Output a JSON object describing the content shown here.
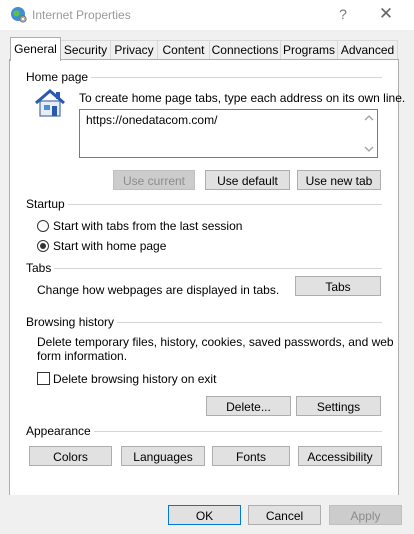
{
  "window": {
    "title": "Internet Properties",
    "help_glyph": "?",
    "close_glyph": "✕",
    "icon": "globe-settings-icon"
  },
  "tabs": [
    {
      "label": "General",
      "active": true
    },
    {
      "label": "Security"
    },
    {
      "label": "Privacy"
    },
    {
      "label": "Content"
    },
    {
      "label": "Connections"
    },
    {
      "label": "Programs"
    },
    {
      "label": "Advanced"
    }
  ],
  "home_page": {
    "title": "Home page",
    "instruction": "To create home page tabs, type each address on its own line.",
    "url": "https://onedatacom.com/",
    "buttons": {
      "use_current": "Use current",
      "use_default": "Use default",
      "use_new_tab": "Use new tab"
    },
    "icon": "house-icon"
  },
  "startup": {
    "title": "Startup",
    "option_last_session": "Start with tabs from the last session",
    "option_home_page": "Start with home page",
    "selected": "home_page"
  },
  "tabs_section": {
    "title": "Tabs",
    "description": "Change how webpages are displayed in tabs.",
    "button": "Tabs"
  },
  "browsing_history": {
    "title": "Browsing history",
    "description_line1": "Delete temporary files, history, cookies, saved passwords, and web",
    "description_line2": "form information.",
    "delete_on_exit_label": "Delete browsing history on exit",
    "delete_on_exit_checked": false,
    "buttons": {
      "delete": "Delete...",
      "settings": "Settings"
    }
  },
  "appearance": {
    "title": "Appearance",
    "buttons": {
      "colors": "Colors",
      "languages": "Languages",
      "fonts": "Fonts",
      "accessibility": "Accessibility"
    }
  },
  "footer": {
    "ok": "OK",
    "cancel": "Cancel",
    "apply": "Apply"
  }
}
